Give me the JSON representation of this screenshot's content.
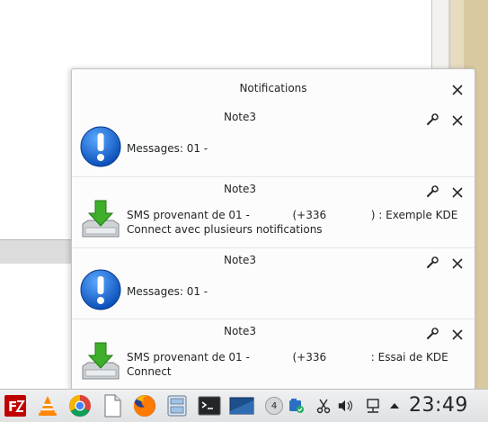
{
  "popup": {
    "title": "Notifications",
    "notifications": [
      {
        "app": "Note3",
        "icon": "information-icon",
        "line1": "Messages: 01 -",
        "line2": ""
      },
      {
        "app": "Note3",
        "icon": "download-icon",
        "line1_a": "SMS provenant de 01 -",
        "line1_b": "(+336",
        "line1_c": ") : Exemple KDE",
        "line2": "Connect avec plusieurs notifications"
      },
      {
        "app": "Note3",
        "icon": "information-icon",
        "line1": "Messages: 01 -",
        "line2": ""
      },
      {
        "app": "Note3",
        "icon": "download-icon",
        "line1_a": "SMS provenant de 01 -",
        "line1_b": "(+336",
        "line1_c": ": Essai de KDE",
        "line2": "Connect"
      }
    ]
  },
  "taskbar": {
    "launchers": [
      "filezilla-icon",
      "vlc-icon",
      "chrome-icon",
      "document-icon",
      "firefox-icon",
      "file-manager-icon",
      "terminal-icon",
      "desktop-icon"
    ],
    "pager_label": "4",
    "tray": [
      "kdeconnect-icon",
      "scissors-icon",
      "volume-icon",
      "network-icon",
      "arrow-up-icon"
    ],
    "clock": "23:49"
  }
}
